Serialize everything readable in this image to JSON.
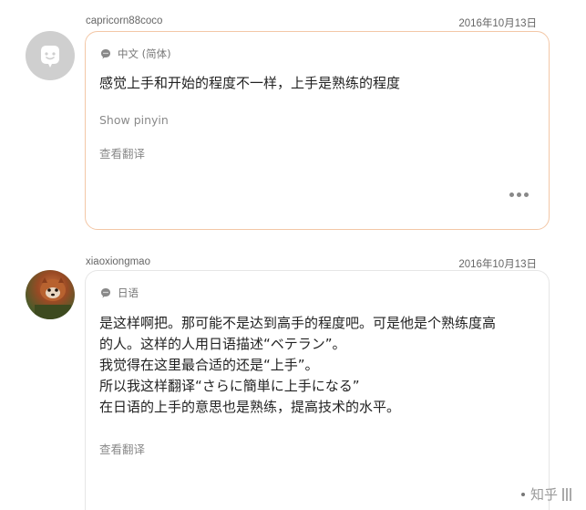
{
  "posts": [
    {
      "username": "capricorn88coco",
      "date": "2016年10月13日",
      "language": "中文 (简体)",
      "content": [
        "感觉上手和开始的程度不一样，上手是熟练的程度"
      ],
      "show_pinyin": "Show pinyin",
      "translate": "查看翻译",
      "avatar_icon": "default-avatar-icon",
      "more_icon": "more-options-icon"
    },
    {
      "username": "xiaoxiongmao",
      "date": "2016年10月13日",
      "language": "日语",
      "content": [
        "是这样啊把。那可能不是达到高手的程度吧。可是他是个熟练度高",
        "的人。这样的人用日语描述“ベテラン”。",
        "我觉得在这里最合适的还是“上手”。",
        "所以我这样翻译“さらに簡単に上手になる”",
        "在日语的上手的意思也是熟练，提高技术的水平。"
      ],
      "translate": "查看翻译",
      "avatar_icon": "red-panda-avatar-photo"
    }
  ],
  "watermark": "知乎"
}
